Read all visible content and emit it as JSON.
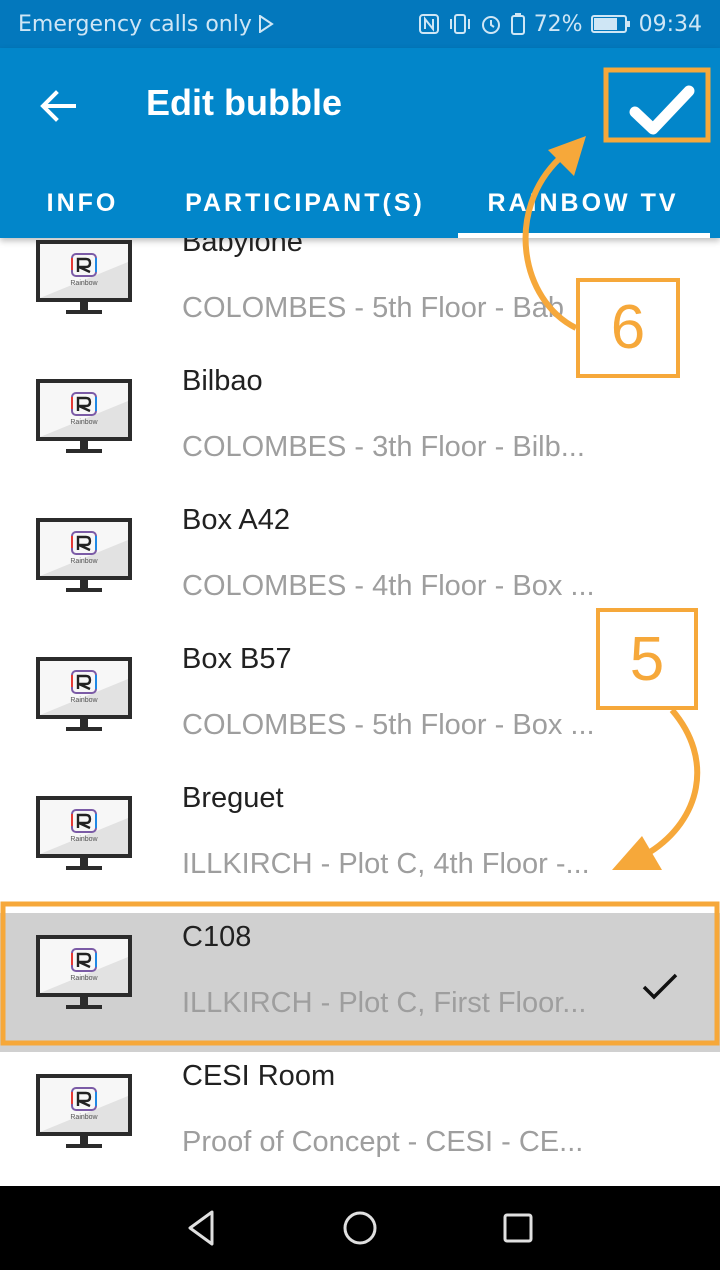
{
  "status_bar": {
    "left_text": "Emergency calls only",
    "battery": "72%",
    "time": "09:34"
  },
  "header": {
    "title": "Edit bubble",
    "back_icon": "arrow-left-icon",
    "confirm_icon": "checkmark-icon"
  },
  "tabs": [
    {
      "label": "INFO"
    },
    {
      "label": "PARTICIPANT(S)"
    },
    {
      "label": "RAINBOW TV"
    }
  ],
  "active_tab": "RAINBOW TV",
  "rooms": [
    {
      "name": "Babylone",
      "location": "COLOMBES - 5th Floor - Bab",
      "selected": false
    },
    {
      "name": "Bilbao",
      "location": "COLOMBES - 3th Floor - Bilb...",
      "selected": false
    },
    {
      "name": "Box A42",
      "location": "COLOMBES - 4th Floor - Box ...",
      "selected": false
    },
    {
      "name": "Box B57",
      "location": "COLOMBES - 5th Floor - Box ...",
      "selected": false
    },
    {
      "name": "Breguet",
      "location": "ILLKIRCH - Plot C, 4th Floor -...",
      "selected": false
    },
    {
      "name": "C108",
      "location": "ILLKIRCH - Plot C, First Floor...",
      "selected": true
    },
    {
      "name": "CESI Room",
      "location": "Proof of Concept - CESI - CE...",
      "selected": false
    }
  ],
  "tv_logo_text": "Rainbow",
  "callouts": [
    {
      "number": "6"
    },
    {
      "number": "5"
    }
  ],
  "colors": {
    "app_bar": "#0286ca",
    "status_bar": "#0378bd",
    "callout": "#f6a83a",
    "selected_row": "#d0d0d0"
  }
}
